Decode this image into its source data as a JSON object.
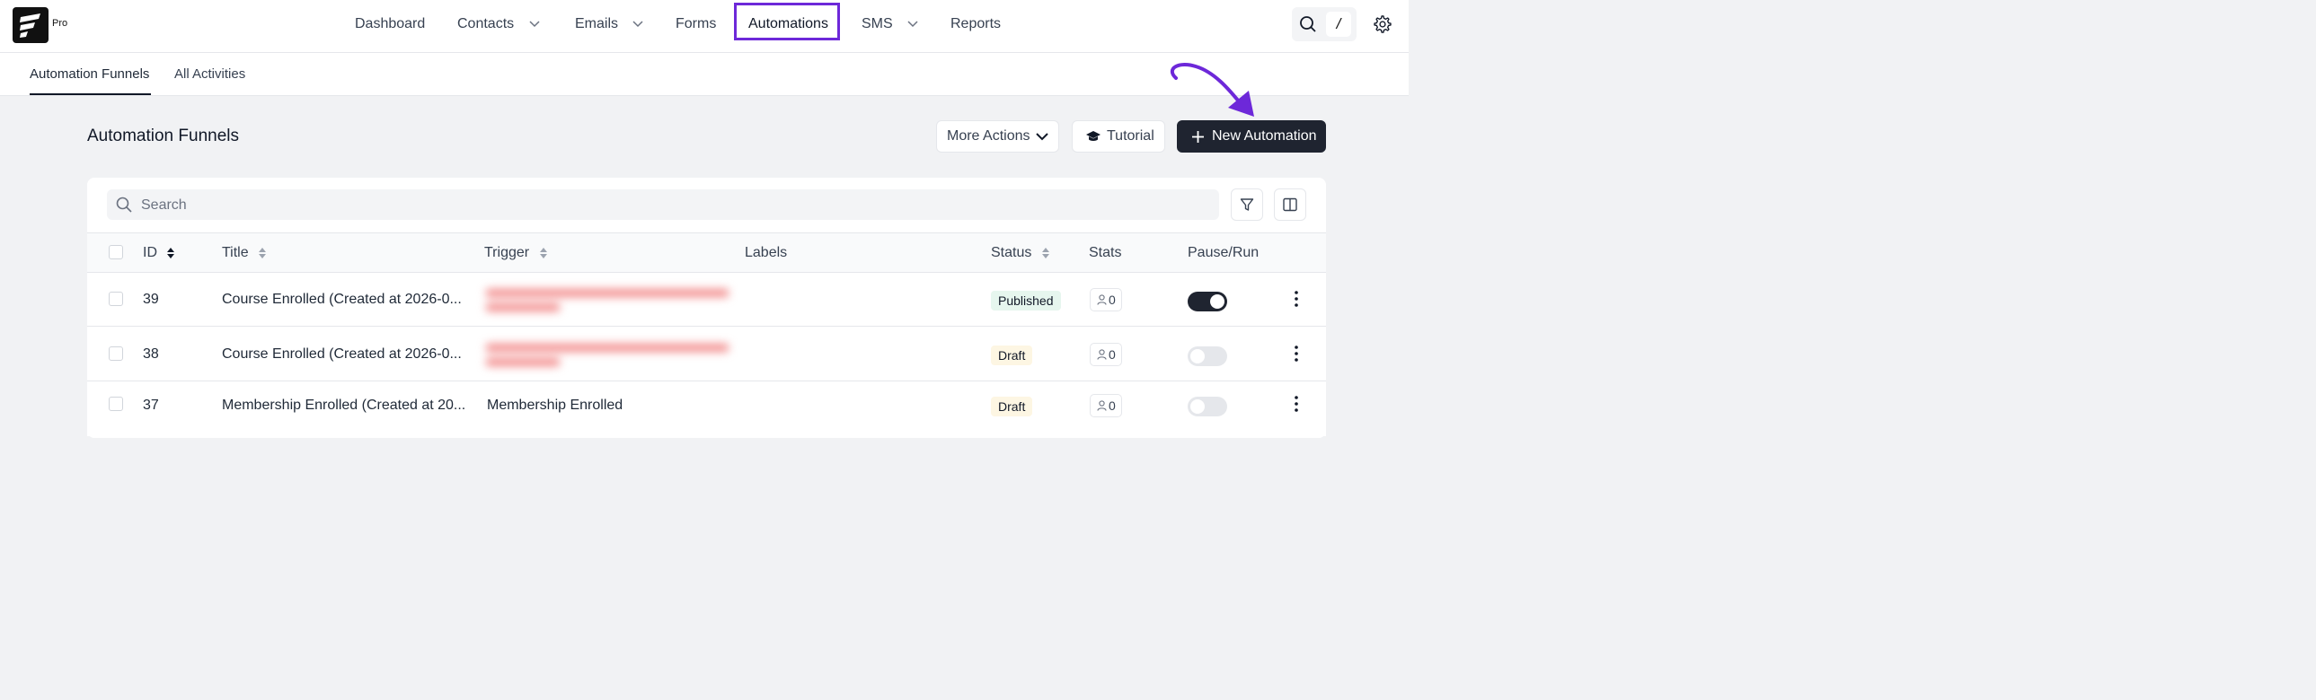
{
  "brand": {
    "logo_text": "Pro"
  },
  "nav": {
    "items": [
      {
        "label": "Dashboard"
      },
      {
        "label": "Contacts"
      },
      {
        "label": "Emails"
      },
      {
        "label": "Forms"
      },
      {
        "label": "Automations"
      },
      {
        "label": "SMS"
      },
      {
        "label": "Reports"
      }
    ],
    "search_shortcut": "/"
  },
  "subtabs": [
    {
      "label": "Automation Funnels"
    },
    {
      "label": "All Activities"
    }
  ],
  "page": {
    "title": "Automation Funnels",
    "more_actions_label": "More Actions",
    "tutorial_label": "Tutorial",
    "new_automation_label": "New Automation"
  },
  "search": {
    "placeholder": "Search"
  },
  "table": {
    "headers": {
      "id": "ID",
      "title": "Title",
      "trigger": "Trigger",
      "labels": "Labels",
      "status": "Status",
      "stats": "Stats",
      "pause_run": "Pause/Run"
    },
    "rows": [
      {
        "id": "39",
        "title": "Course Enrolled (Created at 2026-0...",
        "trigger": "",
        "status": "Published",
        "stats": "0",
        "running": true
      },
      {
        "id": "38",
        "title": "Course Enrolled (Created at 2026-0...",
        "trigger": "",
        "status": "Draft",
        "stats": "0",
        "running": false
      },
      {
        "id": "37",
        "title": "Membership Enrolled (Created at 20...",
        "trigger": "Membership Enrolled",
        "status": "Draft",
        "stats": "0",
        "running": false
      }
    ]
  },
  "colors": {
    "accent": "#6d28d9",
    "dark_button": "#1f2430",
    "published_bg": "#e6f6ee",
    "draft_bg": "#fdf6e3"
  }
}
